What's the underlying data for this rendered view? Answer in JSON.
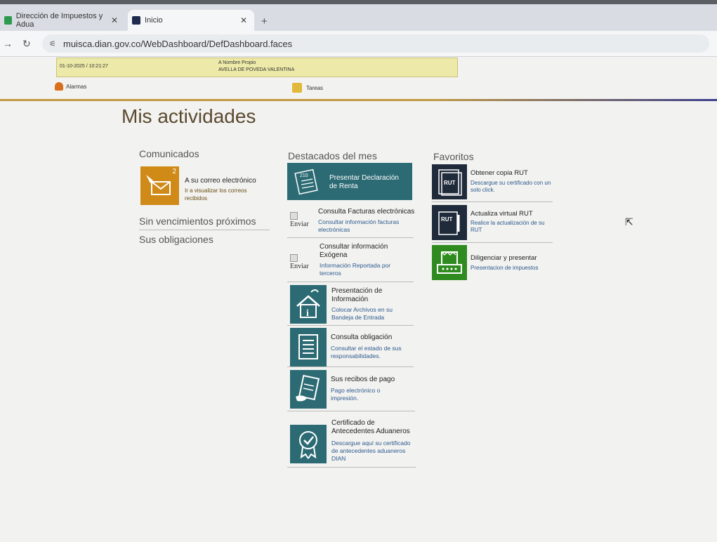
{
  "browser": {
    "tabs": [
      {
        "label": "Dirección de Impuestos y Adua",
        "active": false
      },
      {
        "label": "Inicio",
        "active": true
      }
    ],
    "url": "muisca.dian.gov.co/WebDashboard/DefDashboard.faces"
  },
  "header": {
    "datetime": "01-10-2025 / 10:21:27",
    "owner_label": "A Nombre Propio",
    "owner_name": "AVELLA DE POVEDA VALENTINA",
    "alarmas": "Alarmas",
    "tareas": "Tareas"
  },
  "page": {
    "title": "Mis actividades"
  },
  "comunicados": {
    "heading": "Comunicados",
    "badge": "2",
    "item_title": "A su correo electrónico",
    "item_sub": "Ir a visualizar los correos recibidos"
  },
  "left": {
    "vencimientos": "Sin vencimientos próximos",
    "obligaciones": "Sus obligaciones"
  },
  "destacados": {
    "heading": "Destacados del mes",
    "items": [
      {
        "title": "Presentar Declaración de Renta",
        "sub": ""
      },
      {
        "title": "Consulta Facturas electrónicas",
        "sub": "Consultar información facturas electrónicas",
        "img_alt": "Enviar"
      },
      {
        "title": "Consultar información Exógena",
        "sub": "Información Reportada por terceros",
        "img_alt": "Enviar"
      },
      {
        "title": "Presentación de Información",
        "sub": "Colocar Archivos en su Bandeja de Entrada"
      },
      {
        "title": "Consulta obligación",
        "sub": "Consultar el estado de sus responsabilidades."
      },
      {
        "title": "Sus recibos de pago",
        "sub": "Pago electrónico o impresión."
      },
      {
        "title": "Certificado de Antecedentes Aduaneros",
        "sub": "Descargue aquí su certificado de antecedentes aduaneros DIAN"
      }
    ]
  },
  "favoritos": {
    "heading": "Favoritos",
    "items": [
      {
        "title": "Obtener copia RUT",
        "sub": "Descargue su certificado con un solo click.",
        "icon_text": "RUT"
      },
      {
        "title": "Actualiza virtual RUT",
        "sub": "Realice la actualización de su RUT",
        "icon_text": "RUT"
      },
      {
        "title": "Diligenciar y presentar",
        "sub": "Presentacion de impuestos"
      }
    ]
  },
  "colors": {
    "teal": "#2c6b74",
    "orange": "#d08a18",
    "green": "#2f8b1f",
    "dark": "#1f2a3a"
  }
}
